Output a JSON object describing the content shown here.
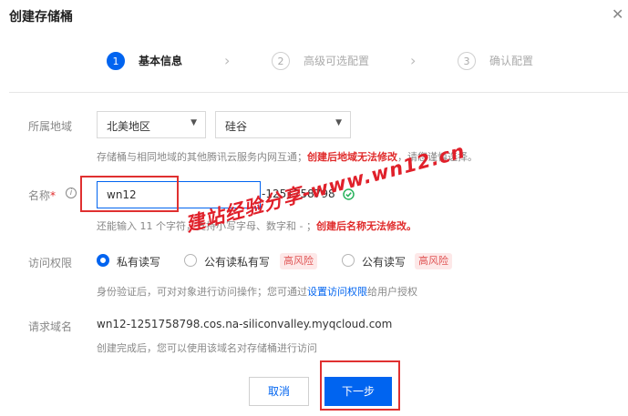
{
  "dialog": {
    "title": "创建存储桶",
    "close": "✕"
  },
  "steps": [
    {
      "number": "1",
      "label": "基本信息",
      "active": true
    },
    {
      "number": "2",
      "label": "高级可选配置",
      "active": false
    },
    {
      "number": "3",
      "label": "确认配置",
      "active": false
    }
  ],
  "region": {
    "label": "所属地域",
    "area": "北美地区",
    "city": "硅谷",
    "help_text": "存储桶与相同地域的其他腾讯云服务内网互通；",
    "help_warning": "创建后地域无法修改",
    "help_suffix": "，请您谨慎选择。"
  },
  "name": {
    "label": "名称",
    "required_mark": "*",
    "value": "wn12",
    "appid_suffix": "-1251758798",
    "help_text": "还能输入 11 个字符，支持小写字母、数字和 - ；",
    "help_warning": "创建后名称无法修改。"
  },
  "access": {
    "label": "访问权限",
    "options": [
      {
        "label": "私有读写",
        "checked": true,
        "tag": ""
      },
      {
        "label": "公有读私有写",
        "checked": false,
        "tag": "高风险"
      },
      {
        "label": "公有读写",
        "checked": false,
        "tag": "高风险"
      }
    ],
    "help_text": "身份验证后，可对对象进行访问操作；您可通过",
    "help_link": "设置访问权限",
    "help_suffix": "给用户授权"
  },
  "domain": {
    "label": "请求域名",
    "value": "wn12-1251758798.cos.na-siliconvalley.myqcloud.com",
    "help_text": "创建完成后，您可以使用该域名对存储桶进行访问"
  },
  "buttons": {
    "cancel": "取消",
    "next": "下一步"
  },
  "watermark": "建站经验分享-www.wn12.cn",
  "colors": {
    "primary": "#0064f0",
    "danger": "#e02b2b",
    "success": "#29b35c"
  },
  "icons": {
    "check": "check-circle-icon",
    "info": "info-icon"
  }
}
